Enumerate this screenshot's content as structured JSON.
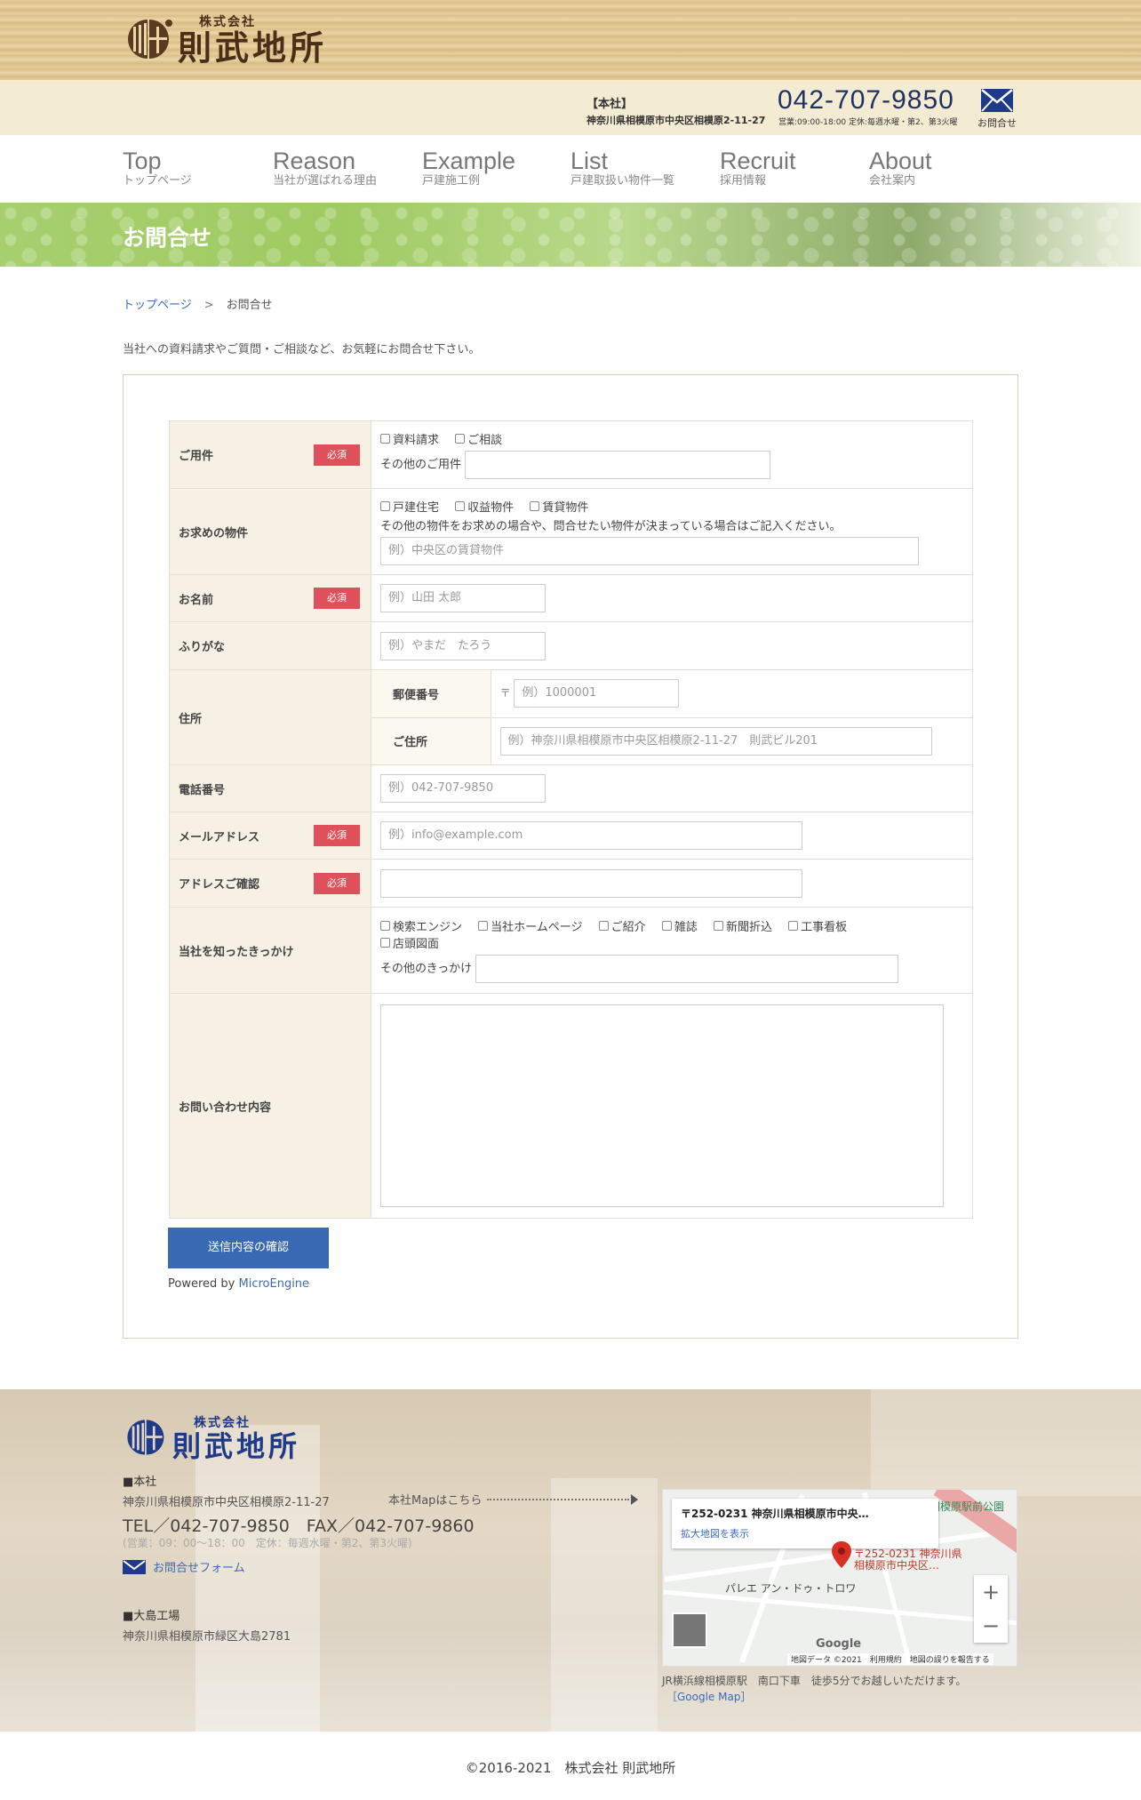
{
  "header": {
    "logo_small": "株式会社",
    "logo_big": "則武地所",
    "hq_label": "【本社】",
    "hq_address": "神奈川県相模原市中央区相模原2-11-27",
    "phone": "042-707-9850",
    "hours": "営業:09:00-18:00 定休:毎週水曜・第2、第3火曜",
    "contact_label": "お問合せ"
  },
  "nav": [
    {
      "en": "Top",
      "ja": "トップページ"
    },
    {
      "en": "Reason",
      "ja": "当社が選ばれる理由"
    },
    {
      "en": "Example",
      "ja": "戸建施工例"
    },
    {
      "en": "List",
      "ja": "戸建取扱い物件一覧"
    },
    {
      "en": "Recruit",
      "ja": "採用情報"
    },
    {
      "en": "About",
      "ja": "会社案内"
    }
  ],
  "banner": {
    "title": "お問合せ"
  },
  "breadcrumb": {
    "home": "トップページ",
    "sep": ">",
    "current": "お問合せ"
  },
  "intro": "当社への資料請求やご質問・ご相談など、お気軽にお問合せ下さい。",
  "form": {
    "required_label": "必須",
    "youken": {
      "label": "ご用件",
      "options": [
        "資料請求",
        "ご相談"
      ],
      "other_label": "その他のご用件"
    },
    "property": {
      "label": "お求めの物件",
      "options": [
        "戸建住宅",
        "収益物件",
        "賃貸物件"
      ],
      "note": "その他の物件をお求めの場合や、問合せたい物件が決まっている場合はご記入ください。",
      "placeholder": "例）中央区の賃貸物件"
    },
    "name": {
      "label": "お名前",
      "placeholder": "例）山田 太郎"
    },
    "furigana": {
      "label": "ふりがな",
      "placeholder": "例）やまだ　たろう"
    },
    "address": {
      "label": "住所",
      "zip_label": "郵便番号",
      "zip_prefix": "〒",
      "zip_placeholder": "例）1000001",
      "addr_label": "ご住所",
      "addr_placeholder": "例）神奈川県相模原市中央区相模原2-11-27　則武ビル201"
    },
    "tel": {
      "label": "電話番号",
      "placeholder": "例）042-707-9850"
    },
    "email": {
      "label": "メールアドレス",
      "placeholder": "例）info@example.com"
    },
    "email_confirm": {
      "label": "アドレスご確認",
      "placeholder": ""
    },
    "source": {
      "label": "当社を知ったきっかけ",
      "options": [
        "検索エンジン",
        "当社ホームページ",
        "ご紹介",
        "雑誌",
        "新聞折込",
        "工事看板",
        "店頭図面"
      ],
      "other_label": "その他のきっかけ"
    },
    "inquiry": {
      "label": "お問い合わせ内容"
    },
    "submit": "送信内容の確認",
    "powered_by": "Powered by",
    "powered_link": "MicroEngine"
  },
  "footer": {
    "logo_small": "株式会社",
    "logo_big": "則武地所",
    "hq_label": "■本社",
    "hq_address": "神奈川県相模原市中央区相模原2-11-27",
    "map_link": "本社Mapはこちら",
    "tel_fax": "TEL／042-707-9850　FAX／042-707-9860",
    "hours": "(営業：09：00～18：00　定休：毎週水曜・第2、第3火曜)",
    "contact_form": "お問合せフォーム",
    "oshima_label": "■大島工場",
    "oshima_address": "神奈川県相模原市緑区大島2781",
    "map": {
      "card_address": "〒252-0231 神奈川県相模原市中央…",
      "enlarge": "拡大地図を表示",
      "pin_label_1": "〒252-0231 神奈川県",
      "pin_label_2": "相模原市中央区…",
      "park": "相模原駅前公園",
      "place": "パレエ アン・ドゥ・トロワ",
      "google": "Google",
      "footer": "地図データ ©2021　利用規約　地図の誤りを報告する"
    },
    "map_caption": "JR横浜線相模原駅　南口下車　徒歩5分でお越しいただけます。",
    "google_map_link": "［Google Map］",
    "copyright": "©2016-2021　株式会社 則武地所"
  },
  "colors": {
    "accent_blue": "#3a69b3",
    "required_red": "#e0505a",
    "banner_green": "#a6cf6e",
    "phone_navy": "#1e3264"
  }
}
